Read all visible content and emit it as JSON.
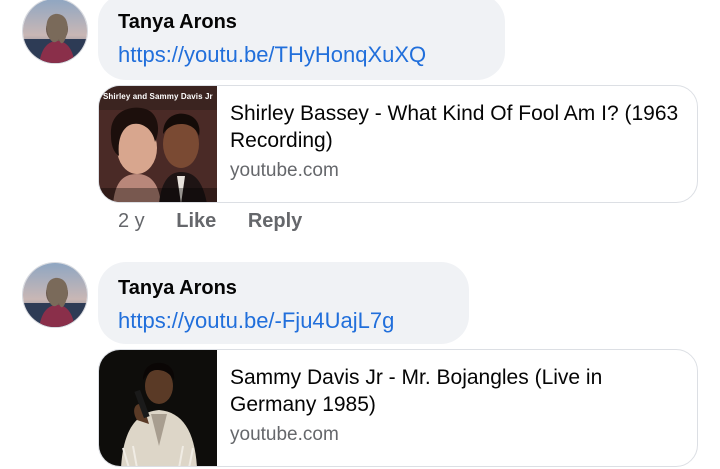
{
  "comments": [
    {
      "author": "Tanya Arons",
      "link_text": "https://youtu.be/THyHonqXuXQ",
      "preview": {
        "title": "Shirley Bassey - What Kind Of Fool Am I? (1963 Recording)",
        "domain": "youtube.com",
        "thumbnail_caption": "Shirley and Sammy Davis Jr"
      },
      "actions": {
        "time": "2 y",
        "like": "Like",
        "reply": "Reply"
      }
    },
    {
      "author": "Tanya Arons",
      "link_text": "https://youtu.be/-Fju4UajL7g",
      "preview": {
        "title": "Sammy Davis Jr - Mr. Bojangles (Live in Germany 1985)",
        "domain": "youtube.com"
      }
    }
  ],
  "colors": {
    "bubble_bg": "#f0f2f5",
    "link": "#216fdb",
    "secondary_text": "#65676b",
    "primary_text": "#050505"
  }
}
